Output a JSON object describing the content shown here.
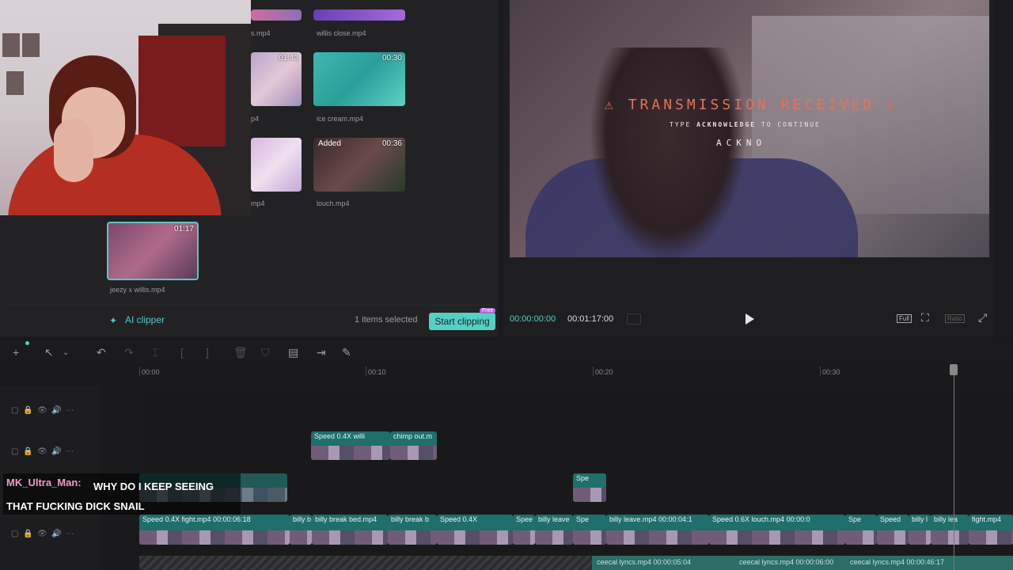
{
  "media": {
    "items": [
      {
        "name": "s.mp4",
        "duration": ""
      },
      {
        "name": "willis close.mp4",
        "duration": ""
      },
      {
        "name": "p4",
        "duration": "01:43"
      },
      {
        "name": "ice cream.mp4",
        "duration": "00:30"
      },
      {
        "name": "mp4",
        "duration": ""
      },
      {
        "name": "louch.mp4",
        "duration": "00:36",
        "badge": "Added"
      },
      {
        "name": "jeezy x willis.mp4",
        "duration": "01:17"
      }
    ],
    "ai_clipper_label": "AI clipper",
    "selected_count": "1 items selected",
    "start_clipping": "Start clipping",
    "free_badge": "Free"
  },
  "player": {
    "overlay_title": "TRANSMISSION RECEIVED",
    "overlay_sub_pre": "TYPE ",
    "overlay_sub_key": "ACKNOWLEDGE",
    "overlay_sub_post": " TO CONTINUE",
    "overlay_input": "ACKNO",
    "current_time": "00:00:00:00",
    "total_time": "00:01:17:00",
    "full_label": "Full",
    "ratio_label": "Ratio"
  },
  "toolbar": {
    "icons": [
      "add-icon",
      "select-icon",
      "chevron-down-icon",
      "undo-icon",
      "redo-icon",
      "split-icon",
      "trim-left-icon",
      "trim-right-icon",
      "delete-icon",
      "shield-icon",
      "caption-icon",
      "insert-icon",
      "magic-icon"
    ]
  },
  "ruler": {
    "ticks": [
      "00:00",
      "00:10",
      "00:20",
      "00:30"
    ]
  },
  "timeline": {
    "clips_track2": [
      {
        "label": "Speed 0.4X  willi"
      },
      {
        "label": "chimp out.m"
      }
    ],
    "clips_track3": [
      {
        "label": "Spe"
      }
    ],
    "clips_main": [
      {
        "label": "Speed 0.4X  fight.mp4  00:00:06:18"
      },
      {
        "label": "billy b"
      },
      {
        "label": "billy break bed.mp4"
      },
      {
        "label": "billy break b"
      },
      {
        "label": "Speed 0.4X"
      },
      {
        "label": "Spee"
      },
      {
        "label": "billy leave"
      },
      {
        "label": "Spe"
      },
      {
        "label": "billy leave.mp4  00:00:04:1"
      },
      {
        "label": "Speed 0.6X  louch.mp4  00:00:0"
      },
      {
        "label": "Spe"
      },
      {
        "label": "Speed"
      },
      {
        "label": "billy l"
      },
      {
        "label": "billy lea"
      },
      {
        "label": "fight.mp4"
      }
    ],
    "audio": [
      {
        "label": "ceecal lyncs.mp4  00:00:05:04"
      },
      {
        "label": "ceecal lyncs.mp4  00:00:06:00"
      },
      {
        "label": "ceecal lyncs.mp4  00:00:46:17"
      }
    ]
  },
  "chat": {
    "username": "MK_Ultra_Man:",
    "message": "WHY DO I KEEP SEEING THAT FUCKING DICK SNAIL"
  },
  "colors": {
    "accent": "#55d0c4",
    "clip": "#1f6f6b",
    "overlay_red": "#e0745a"
  }
}
